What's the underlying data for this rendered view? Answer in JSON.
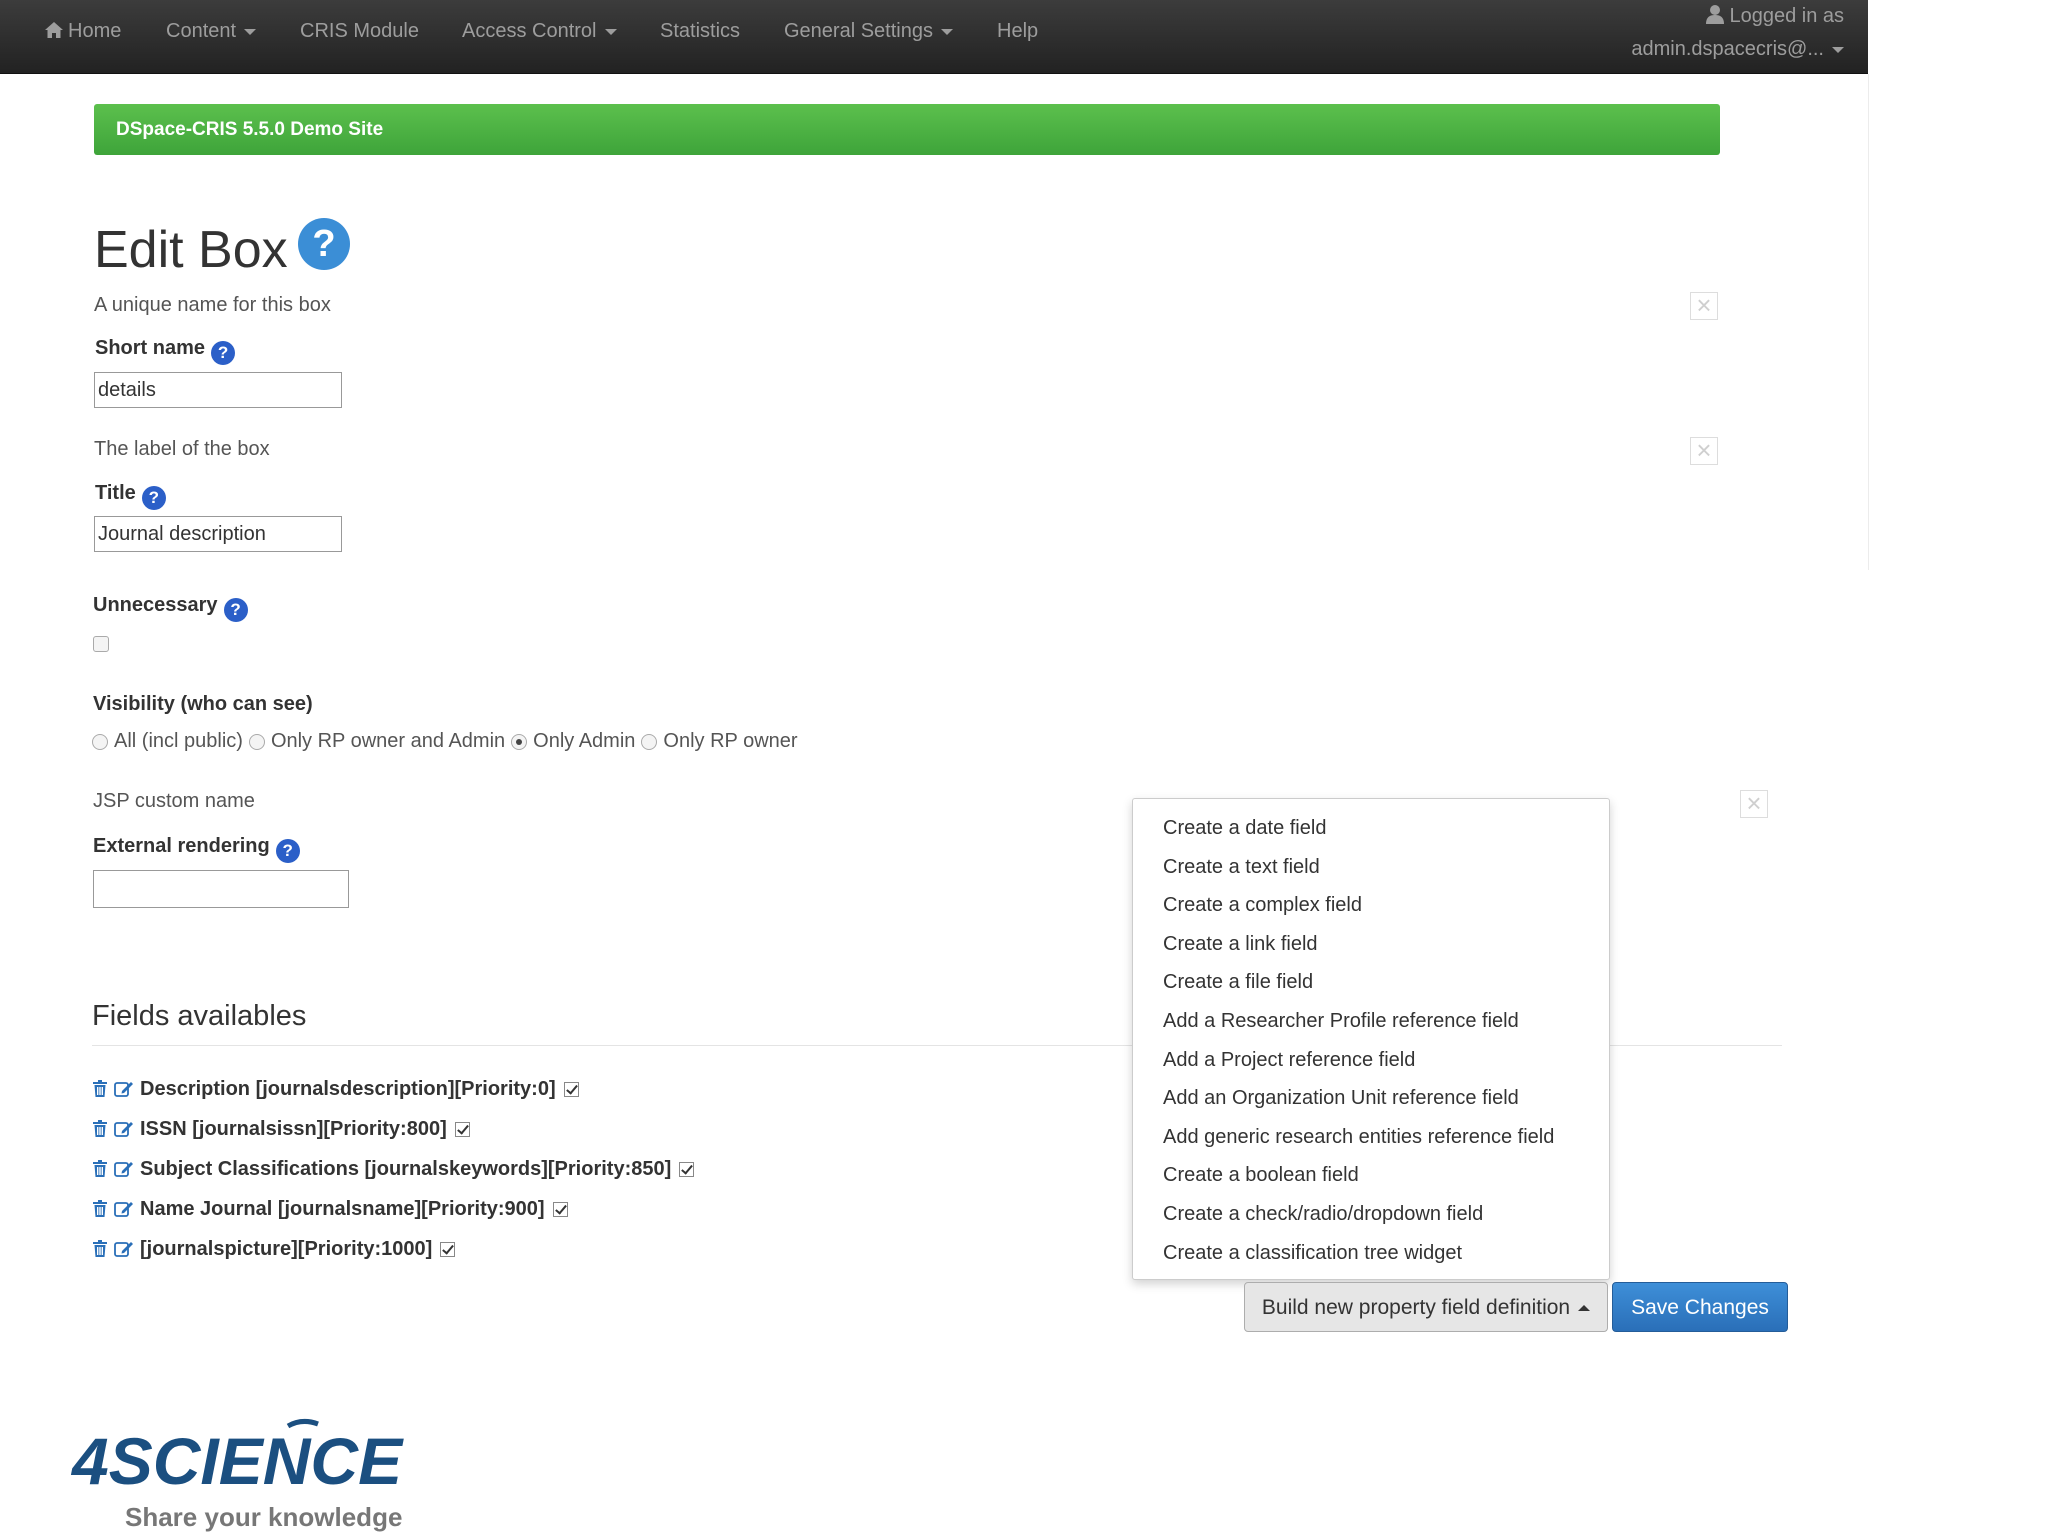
{
  "navbar": {
    "items": [
      {
        "label": "Home",
        "icon": "home-icon",
        "dropdown": false
      },
      {
        "label": "Content",
        "dropdown": true
      },
      {
        "label": "CRIS Module",
        "dropdown": false
      },
      {
        "label": "Access Control",
        "dropdown": true
      },
      {
        "label": "Statistics",
        "dropdown": false
      },
      {
        "label": "General Settings",
        "dropdown": true
      },
      {
        "label": "Help",
        "dropdown": false
      }
    ],
    "login_line1": "Logged in as",
    "login_line2": "admin.dspacecris@...",
    "text_color": "#9d9d9d",
    "background": "#2b2b2b"
  },
  "banner": {
    "text": "DSpace-CRIS 5.5.0 Demo Site",
    "color": "#4cb444"
  },
  "page": {
    "title": "Edit Box",
    "help_icon": "question-circle-icon"
  },
  "form": {
    "short_name": {
      "hint": "A unique name for this box",
      "label": "Short name",
      "value": "details"
    },
    "title": {
      "hint": "The label of the box",
      "label": "Title",
      "value": "Journal description"
    },
    "unnecessary": {
      "label": "Unnecessary",
      "checked": false
    },
    "visibility": {
      "label": "Visibility (who can see)",
      "options": [
        {
          "label": "All (incl public)",
          "selected": false
        },
        {
          "label": "Only RP owner and Admin",
          "selected": false
        },
        {
          "label": "Only Admin",
          "selected": true
        },
        {
          "label": "Only RP owner",
          "selected": false
        }
      ]
    },
    "jsp": {
      "hint": "JSP custom name",
      "label": "External rendering",
      "value": ""
    }
  },
  "fields": {
    "title": "Fields availables",
    "items": [
      {
        "label": "Description [journalsdescription][Priority:0]",
        "checked": true
      },
      {
        "label": "ISSN [journalsissn][Priority:800]",
        "checked": true
      },
      {
        "label": "Subject Classifications [journalskeywords][Priority:850]",
        "checked": true
      },
      {
        "label": "Name Journal [journalsname][Priority:900]",
        "checked": true
      },
      {
        "label": "[journalspicture][Priority:1000]",
        "checked": true
      }
    ]
  },
  "dropdown_menu": {
    "items": [
      "Create a date field",
      "Create a text field",
      "Create a complex field",
      "Create a link field",
      "Create a file field",
      "Add a Researcher Profile reference field",
      "Add a Project reference field",
      "Add an Organization Unit reference field",
      "Add generic research entities reference field",
      "Create a boolean field",
      "Create a check/radio/dropdown field",
      "Create a classification tree widget"
    ]
  },
  "buttons": {
    "build_label": "Build new property field definition",
    "save_label": "Save Changes",
    "save_color": "#337ab7"
  },
  "logo": {
    "name": "4SCIENCE",
    "tagline": "Share your knowledge",
    "color": "#1b4f80"
  }
}
